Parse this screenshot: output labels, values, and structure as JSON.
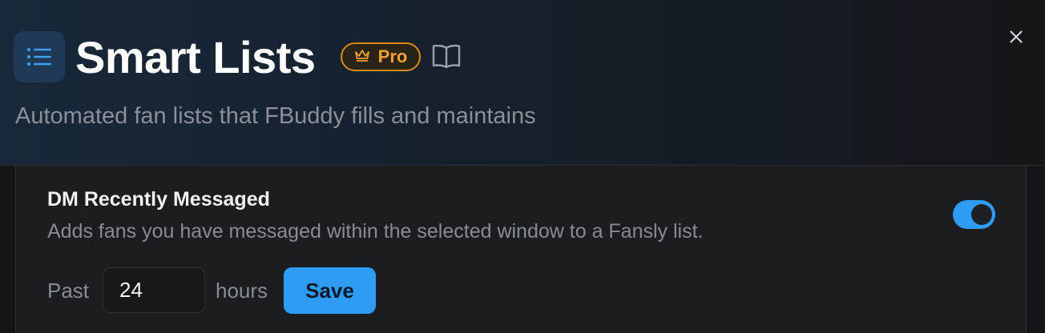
{
  "header": {
    "title": "Smart Lists",
    "pro_badge": "Pro",
    "subtitle": "Automated fan lists that FBuddy fills and maintains"
  },
  "icons": {
    "app": "list-icon",
    "pro": "crown-icon",
    "docs": "book-icon",
    "close": "close-icon"
  },
  "colors": {
    "accent": "#2f9cf4",
    "pro": "#f0a030",
    "background": "#141518"
  },
  "card": {
    "title": "DM Recently Messaged",
    "description": "Adds fans you have messaged within the selected window to a Fansly list.",
    "enabled": true,
    "past_label": "Past",
    "hours_value": "24",
    "hours_label": "hours",
    "save_label": "Save"
  }
}
